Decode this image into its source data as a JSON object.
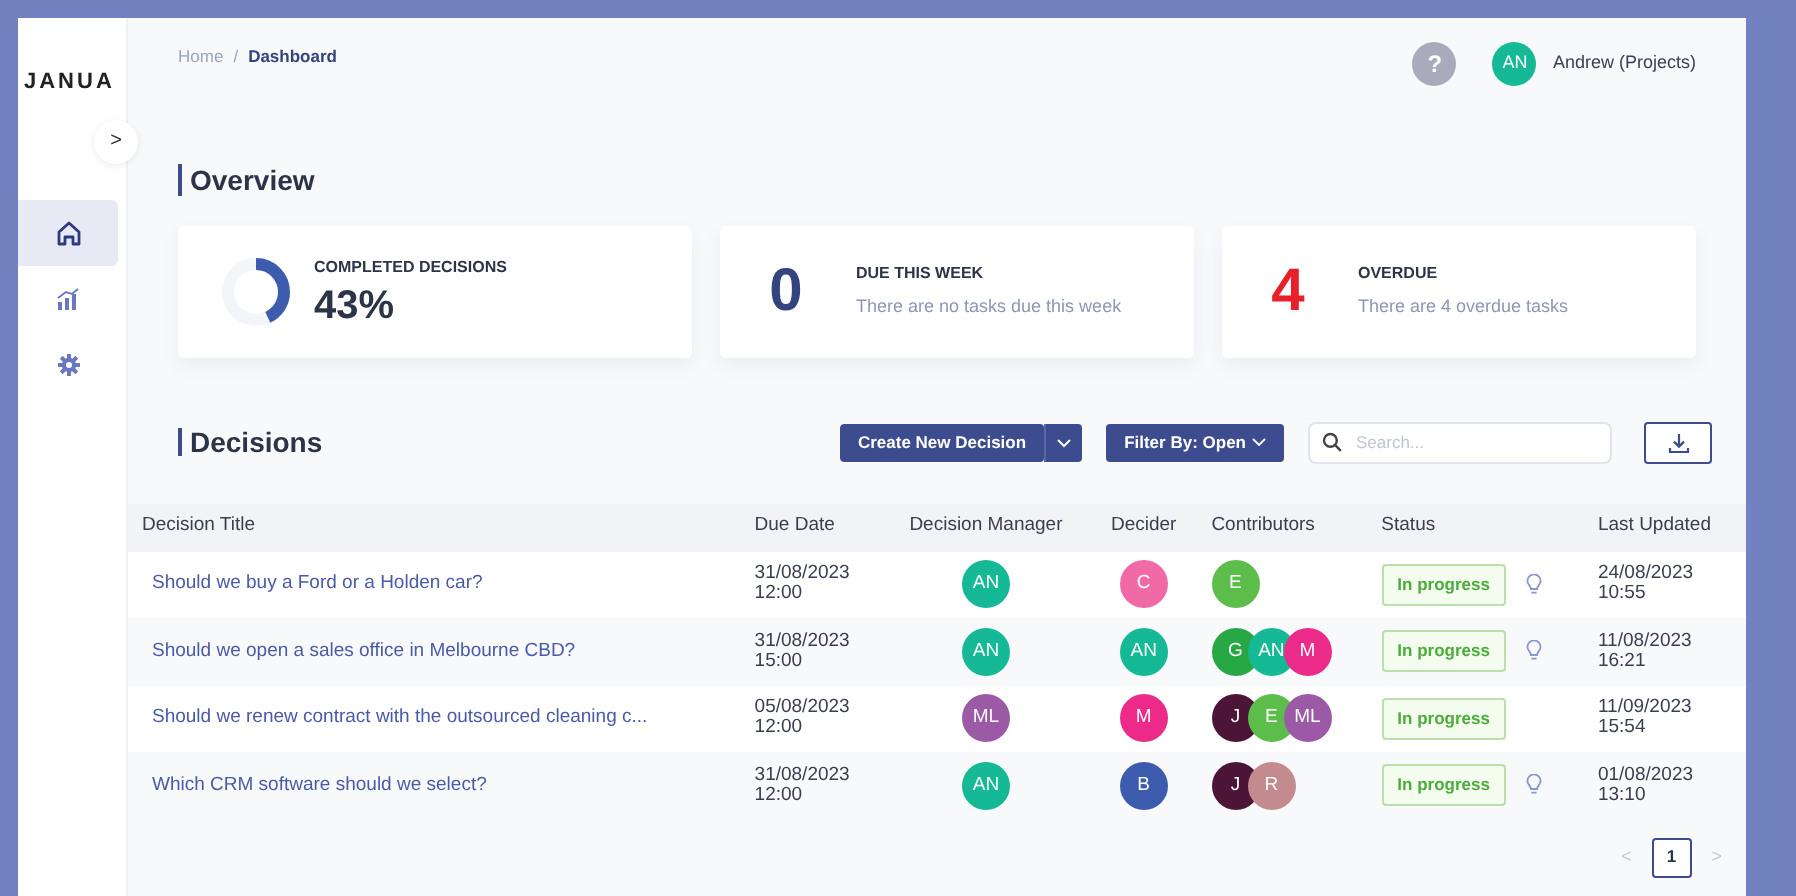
{
  "sidebar": {
    "logo": "JANUA",
    "toggle": ">",
    "items": [
      {
        "kind": "home",
        "selected": true
      },
      {
        "kind": "chart",
        "selected": false
      },
      {
        "kind": "gear",
        "selected": false
      }
    ]
  },
  "breadcrumb": {
    "separator": "/",
    "items": [
      {
        "label": "Home",
        "current": false
      },
      {
        "label": "Dashboard",
        "current": true
      }
    ]
  },
  "header": {
    "help": "?",
    "user": {
      "initials": "AN",
      "color": "#15b996",
      "name": "Andrew (Projects)"
    }
  },
  "overview": {
    "title": "Overview",
    "cards": [
      {
        "kind": "donut",
        "level": 0.43,
        "label": "COMPLETED DECISIONS",
        "value": "43%"
      },
      {
        "kind": "number",
        "label": "DUE THIS WEEK",
        "count": "0",
        "color": "#34447f",
        "text": "There are no tasks due this week"
      },
      {
        "kind": "number",
        "label": "OVERDUE",
        "count": "4",
        "color": "#e8202a",
        "text": "There are 4 overdue tasks"
      }
    ]
  },
  "decisions": {
    "title": "Decisions",
    "create_button": "Create New Decision",
    "filter_button": "Filter By: Open",
    "search": {
      "placeholder": "Search..."
    },
    "columns": [
      "Decision Title",
      "Due Date",
      "Decision Manager",
      "Decider",
      "Contributors",
      "Status",
      "Last Updated"
    ],
    "rows": [
      {
        "title": "Should we buy a Ford or a Holden car?",
        "due": "31/08/2023\n12:00",
        "manager": {
          "initials": "AN",
          "color": "#15b996"
        },
        "decider": {
          "initials": "C",
          "color": "#f06aa5"
        },
        "contributors": [
          {
            "initials": "E",
            "color": "#5cbd4a"
          }
        ],
        "status": "In progress",
        "hint": true,
        "updated": "24/08/2023\n10:55"
      },
      {
        "title": "Should we open a sales office in Melbourne CBD?",
        "due": "31/08/2023\n15:00",
        "manager": {
          "initials": "AN",
          "color": "#15b996"
        },
        "decider": {
          "initials": "AN",
          "color": "#15b996"
        },
        "contributors": [
          {
            "initials": "G",
            "color": "#27a844"
          },
          {
            "initials": "AN",
            "color": "#15b996"
          },
          {
            "initials": "M",
            "color": "#ec2a8a"
          }
        ],
        "status": "In progress",
        "hint": true,
        "updated": "11/08/2023\n16:21"
      },
      {
        "title": "Should we renew contract with the outsourced cleaning c...",
        "due": "05/08/2023\n12:00",
        "manager": {
          "initials": "ML",
          "color": "#9b59a6"
        },
        "decider": {
          "initials": "M",
          "color": "#ec2a8a"
        },
        "contributors": [
          {
            "initials": "J",
            "color": "#4b1538"
          },
          {
            "initials": "E",
            "color": "#5cbd4a"
          },
          {
            "initials": "ML",
            "color": "#9b59a6"
          }
        ],
        "status": "In progress",
        "hint": false,
        "updated": "11/09/2023\n15:54"
      },
      {
        "title": "Which CRM software should we select?",
        "due": "31/08/2023\n12:00",
        "manager": {
          "initials": "AN",
          "color": "#15b996"
        },
        "decider": {
          "initials": "B",
          "color": "#3d5cad"
        },
        "contributors": [
          {
            "initials": "J",
            "color": "#4b1538"
          },
          {
            "initials": "R",
            "color": "#c48b8f"
          }
        ],
        "status": "In progress",
        "hint": true,
        "updated": "01/08/2023\n13:10"
      }
    ]
  },
  "pagination": {
    "prev": "<",
    "next": ">",
    "pages": [
      {
        "label": "1",
        "selected": true
      }
    ]
  }
}
